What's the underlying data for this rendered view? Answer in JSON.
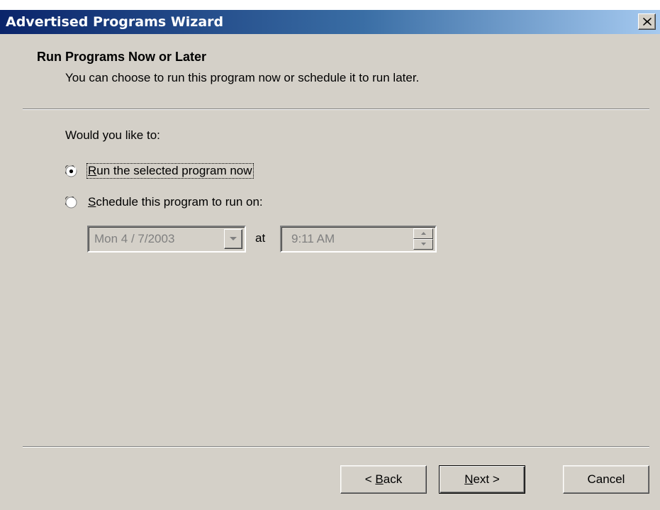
{
  "window": {
    "title": "Advertised Programs Wizard"
  },
  "header": {
    "title": "Run Programs Now or Later",
    "subtitle": "You can choose to run this program now or schedule it to run later."
  },
  "body": {
    "question": "Would you like to:",
    "options": [
      {
        "prefix": "",
        "mnemonic": "R",
        "rest": "un the selected program now",
        "checked": true
      },
      {
        "prefix": "",
        "mnemonic": "S",
        "rest": "chedule this program to run on:",
        "checked": false
      }
    ],
    "schedule": {
      "date_value": "Mon  4 / 7/2003",
      "at_label": "at",
      "time_value": "9:11 AM",
      "enabled": false
    }
  },
  "buttons": {
    "back_prefix": "< ",
    "back_mnemonic": "B",
    "back_rest": "ack",
    "next_mnemonic": "N",
    "next_rest": "ext >",
    "cancel": "Cancel"
  },
  "colors": {
    "dialog_bg": "#d4d0c8",
    "titlebar_start": "#0a246a",
    "titlebar_end": "#a6caf0",
    "disabled_text": "#808080"
  }
}
